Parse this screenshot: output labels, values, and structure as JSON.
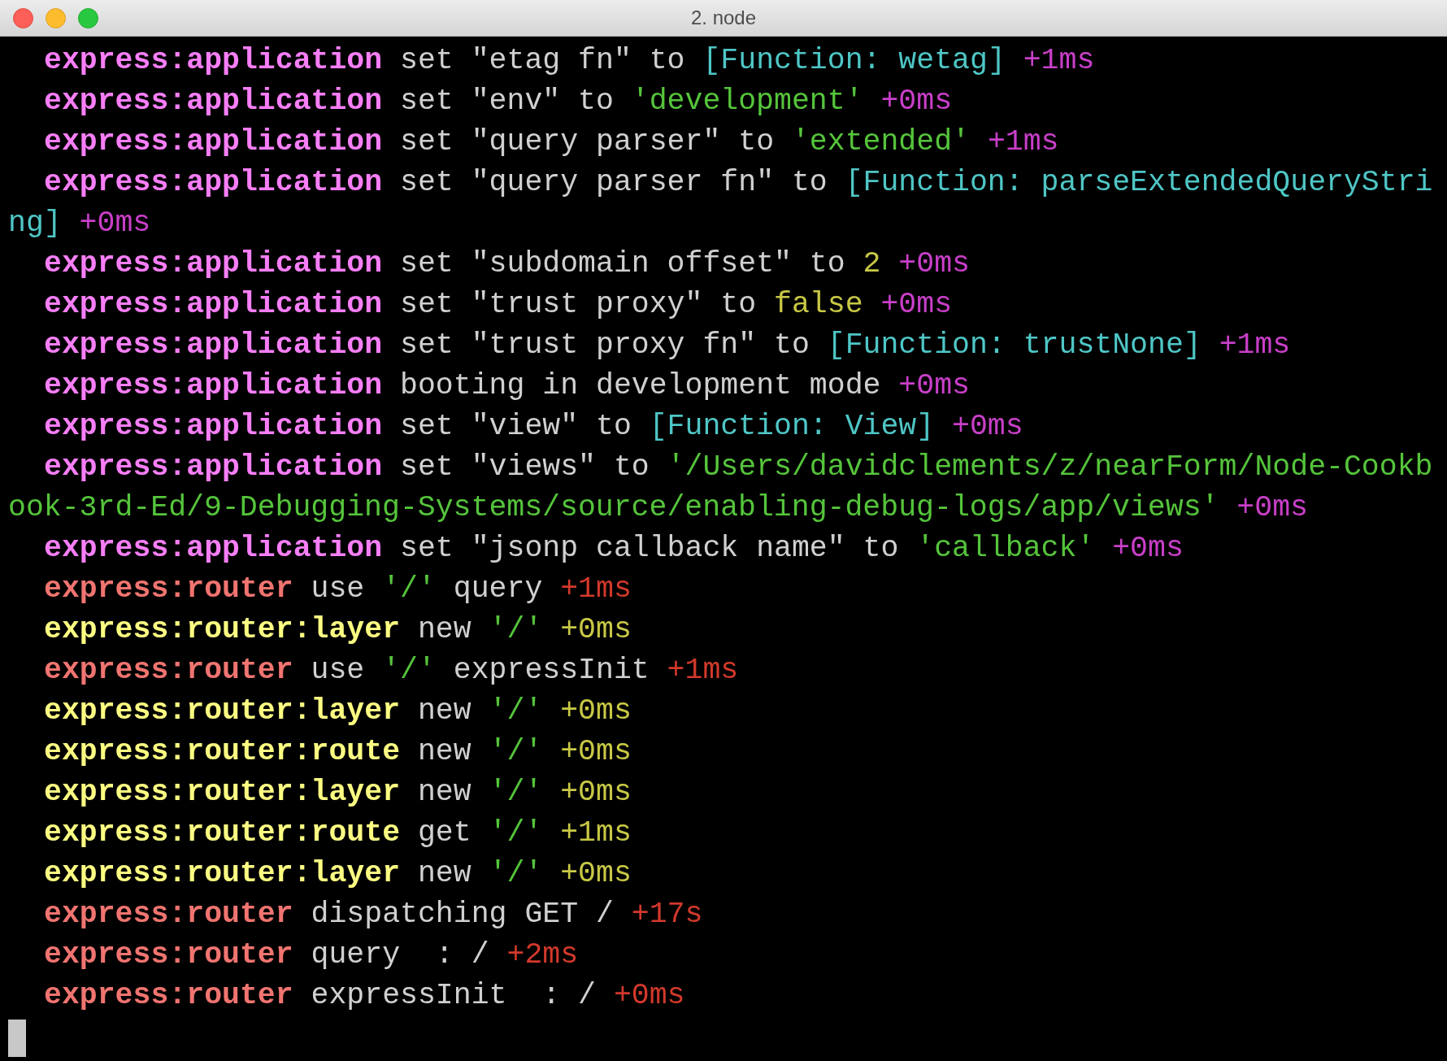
{
  "window": {
    "title": "2. node"
  },
  "entries": [
    {
      "rows": [
        {
          "segments": [
            {
              "text": "express:application",
              "color": "#f77ef7",
              "kind": "namespace"
            },
            {
              "text": "set \"etag fn\" to",
              "color": "#d0d0d0",
              "kind": "text"
            },
            {
              "text": "[Function: wetag]",
              "color": "#4fc6c6",
              "kind": "text"
            },
            {
              "text": "+1ms",
              "color": "#c93fc9",
              "kind": "text"
            }
          ]
        }
      ]
    },
    {
      "rows": [
        {
          "segments": [
            {
              "text": "express:application",
              "color": "#f77ef7",
              "kind": "namespace"
            },
            {
              "text": "set \"env\" to",
              "color": "#d0d0d0",
              "kind": "text"
            },
            {
              "text": "'development'",
              "color": "#55c43b",
              "kind": "text"
            },
            {
              "text": "+0ms",
              "color": "#c93fc9",
              "kind": "text"
            }
          ]
        }
      ]
    },
    {
      "rows": [
        {
          "segments": [
            {
              "text": "express:application",
              "color": "#f77ef7",
              "kind": "namespace"
            },
            {
              "text": "set \"query parser\" to",
              "color": "#d0d0d0",
              "kind": "text"
            },
            {
              "text": "'extended'",
              "color": "#55c43b",
              "kind": "text"
            },
            {
              "text": "+1ms",
              "color": "#c93fc9",
              "kind": "text"
            }
          ]
        }
      ]
    },
    {
      "rows": [
        {
          "segments": [
            {
              "text": "express:application",
              "color": "#f77ef7",
              "kind": "namespace"
            },
            {
              "text": "set \"query parser fn\" to",
              "color": "#d0d0d0",
              "kind": "text"
            },
            {
              "text": "[Function: parseExtendedQueryStri",
              "color": "#4fc6c6",
              "kind": "text"
            }
          ]
        },
        {
          "segments": [
            {
              "text": "ng]",
              "color": "#4fc6c6",
              "kind": "text"
            },
            {
              "text": "+0ms",
              "color": "#c93fc9",
              "kind": "text"
            }
          ]
        }
      ]
    },
    {
      "rows": [
        {
          "segments": [
            {
              "text": "express:application",
              "color": "#f77ef7",
              "kind": "namespace"
            },
            {
              "text": "set \"subdomain offset\" to",
              "color": "#d0d0d0",
              "kind": "text"
            },
            {
              "text": "2",
              "color": "#c8c846",
              "kind": "text"
            },
            {
              "text": "+0ms",
              "color": "#c93fc9",
              "kind": "text"
            }
          ]
        }
      ]
    },
    {
      "rows": [
        {
          "segments": [
            {
              "text": "express:application",
              "color": "#f77ef7",
              "kind": "namespace"
            },
            {
              "text": "set \"trust proxy\" to",
              "color": "#d0d0d0",
              "kind": "text"
            },
            {
              "text": "false",
              "color": "#c8c846",
              "kind": "text"
            },
            {
              "text": "+0ms",
              "color": "#c93fc9",
              "kind": "text"
            }
          ]
        }
      ]
    },
    {
      "rows": [
        {
          "segments": [
            {
              "text": "express:application",
              "color": "#f77ef7",
              "kind": "namespace"
            },
            {
              "text": "set \"trust proxy fn\" to",
              "color": "#d0d0d0",
              "kind": "text"
            },
            {
              "text": "[Function: trustNone]",
              "color": "#4fc6c6",
              "kind": "text"
            },
            {
              "text": "+1ms",
              "color": "#c93fc9",
              "kind": "text"
            }
          ]
        }
      ]
    },
    {
      "rows": [
        {
          "segments": [
            {
              "text": "express:application",
              "color": "#f77ef7",
              "kind": "namespace"
            },
            {
              "text": "booting in development mode",
              "color": "#d0d0d0",
              "kind": "text"
            },
            {
              "text": "+0ms",
              "color": "#c93fc9",
              "kind": "text"
            }
          ]
        }
      ]
    },
    {
      "rows": [
        {
          "segments": [
            {
              "text": "express:application",
              "color": "#f77ef7",
              "kind": "namespace"
            },
            {
              "text": "set \"view\" to",
              "color": "#d0d0d0",
              "kind": "text"
            },
            {
              "text": "[Function: View]",
              "color": "#4fc6c6",
              "kind": "text"
            },
            {
              "text": "+0ms",
              "color": "#c93fc9",
              "kind": "text"
            }
          ]
        }
      ]
    },
    {
      "rows": [
        {
          "segments": [
            {
              "text": "express:application",
              "color": "#f77ef7",
              "kind": "namespace"
            },
            {
              "text": "set \"views\" to",
              "color": "#d0d0d0",
              "kind": "text"
            },
            {
              "text": "'/Users/davidclements/z/nearForm/Node-Cookb",
              "color": "#55c43b",
              "kind": "text"
            }
          ]
        },
        {
          "segments": [
            {
              "text": "ook-3rd-Ed/9-Debugging-Systems/source/enabling-debug-logs/app/views'",
              "color": "#55c43b",
              "kind": "text"
            },
            {
              "text": "+0ms",
              "color": "#c93fc9",
              "kind": "text"
            }
          ]
        }
      ]
    },
    {
      "rows": [
        {
          "segments": [
            {
              "text": "express:application",
              "color": "#f77ef7",
              "kind": "namespace"
            },
            {
              "text": "set \"jsonp callback name\" to",
              "color": "#d0d0d0",
              "kind": "text"
            },
            {
              "text": "'callback'",
              "color": "#55c43b",
              "kind": "text"
            },
            {
              "text": "+0ms",
              "color": "#c93fc9",
              "kind": "text"
            }
          ]
        }
      ]
    },
    {
      "rows": [
        {
          "segments": [
            {
              "text": "express:router",
              "color": "#f07470",
              "kind": "namespace"
            },
            {
              "text": "use",
              "color": "#d0d0d0",
              "kind": "text"
            },
            {
              "text": "'/'",
              "color": "#55c43b",
              "kind": "text"
            },
            {
              "text": "query",
              "color": "#d0d0d0",
              "kind": "text"
            },
            {
              "text": "+1ms",
              "color": "#d2392b",
              "kind": "text"
            }
          ]
        }
      ]
    },
    {
      "rows": [
        {
          "segments": [
            {
              "text": "express:router:layer",
              "color": "#fcfc82",
              "kind": "namespace"
            },
            {
              "text": "new",
              "color": "#d0d0d0",
              "kind": "text"
            },
            {
              "text": "'/'",
              "color": "#55c43b",
              "kind": "text"
            },
            {
              "text": "+0ms",
              "color": "#c8c846",
              "kind": "text"
            }
          ]
        }
      ]
    },
    {
      "rows": [
        {
          "segments": [
            {
              "text": "express:router",
              "color": "#f07470",
              "kind": "namespace"
            },
            {
              "text": "use",
              "color": "#d0d0d0",
              "kind": "text"
            },
            {
              "text": "'/'",
              "color": "#55c43b",
              "kind": "text"
            },
            {
              "text": "expressInit",
              "color": "#d0d0d0",
              "kind": "text"
            },
            {
              "text": "+1ms",
              "color": "#d2392b",
              "kind": "text"
            }
          ]
        }
      ]
    },
    {
      "rows": [
        {
          "segments": [
            {
              "text": "express:router:layer",
              "color": "#fcfc82",
              "kind": "namespace"
            },
            {
              "text": "new",
              "color": "#d0d0d0",
              "kind": "text"
            },
            {
              "text": "'/'",
              "color": "#55c43b",
              "kind": "text"
            },
            {
              "text": "+0ms",
              "color": "#c8c846",
              "kind": "text"
            }
          ]
        }
      ]
    },
    {
      "rows": [
        {
          "segments": [
            {
              "text": "express:router:route",
              "color": "#fcfc82",
              "kind": "namespace"
            },
            {
              "text": "new",
              "color": "#d0d0d0",
              "kind": "text"
            },
            {
              "text": "'/'",
              "color": "#55c43b",
              "kind": "text"
            },
            {
              "text": "+0ms",
              "color": "#c8c846",
              "kind": "text"
            }
          ]
        }
      ]
    },
    {
      "rows": [
        {
          "segments": [
            {
              "text": "express:router:layer",
              "color": "#fcfc82",
              "kind": "namespace"
            },
            {
              "text": "new",
              "color": "#d0d0d0",
              "kind": "text"
            },
            {
              "text": "'/'",
              "color": "#55c43b",
              "kind": "text"
            },
            {
              "text": "+0ms",
              "color": "#c8c846",
              "kind": "text"
            }
          ]
        }
      ]
    },
    {
      "rows": [
        {
          "segments": [
            {
              "text": "express:router:route",
              "color": "#fcfc82",
              "kind": "namespace"
            },
            {
              "text": "get",
              "color": "#d0d0d0",
              "kind": "text"
            },
            {
              "text": "'/'",
              "color": "#55c43b",
              "kind": "text"
            },
            {
              "text": "+1ms",
              "color": "#c8c846",
              "kind": "text"
            }
          ]
        }
      ]
    },
    {
      "rows": [
        {
          "segments": [
            {
              "text": "express:router:layer",
              "color": "#fcfc82",
              "kind": "namespace"
            },
            {
              "text": "new",
              "color": "#d0d0d0",
              "kind": "text"
            },
            {
              "text": "'/'",
              "color": "#55c43b",
              "kind": "text"
            },
            {
              "text": "+0ms",
              "color": "#c8c846",
              "kind": "text"
            }
          ]
        }
      ]
    },
    {
      "rows": [
        {
          "segments": [
            {
              "text": "express:router",
              "color": "#f07470",
              "kind": "namespace"
            },
            {
              "text": "dispatching GET /",
              "color": "#d0d0d0",
              "kind": "text"
            },
            {
              "text": "+17s",
              "color": "#d2392b",
              "kind": "text"
            }
          ]
        }
      ]
    },
    {
      "rows": [
        {
          "segments": [
            {
              "text": "express:router",
              "color": "#f07470",
              "kind": "namespace"
            },
            {
              "text": "query  : /",
              "color": "#d0d0d0",
              "kind": "text"
            },
            {
              "text": "+2ms",
              "color": "#d2392b",
              "kind": "text"
            }
          ]
        }
      ]
    },
    {
      "rows": [
        {
          "segments": [
            {
              "text": "express:router",
              "color": "#f07470",
              "kind": "namespace"
            },
            {
              "text": "expressInit  : /",
              "color": "#d0d0d0",
              "kind": "text"
            },
            {
              "text": "+0ms",
              "color": "#d2392b",
              "kind": "text"
            }
          ]
        }
      ]
    }
  ]
}
